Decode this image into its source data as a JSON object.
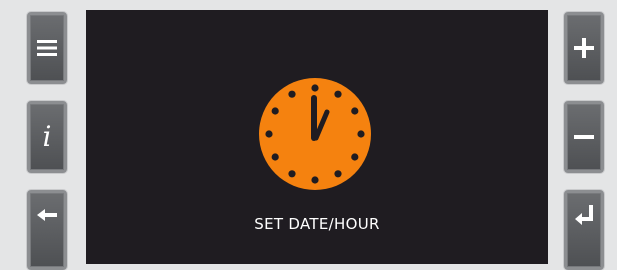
{
  "left_buttons": [
    {
      "icon": "menu-icon"
    },
    {
      "icon": "info-icon",
      "glyph": "i"
    },
    {
      "icon": "back-arrow-icon"
    }
  ],
  "right_buttons": [
    {
      "icon": "plus-icon"
    },
    {
      "icon": "minus-icon"
    },
    {
      "icon": "enter-icon"
    }
  ],
  "screen": {
    "caption": "SET DATE/HOUR",
    "clock_icon": "clock-icon",
    "clock_color": "#f5820f",
    "background": "#1f1c21"
  }
}
